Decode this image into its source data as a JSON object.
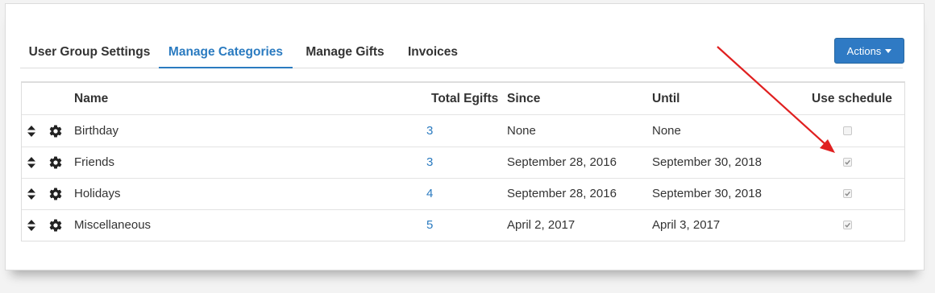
{
  "tabs": [
    {
      "label": "User Group Settings"
    },
    {
      "label": "Manage Categories",
      "active": true
    },
    {
      "label": "Manage Gifts"
    },
    {
      "label": "Invoices"
    }
  ],
  "actions": {
    "label": "Actions"
  },
  "table": {
    "headers": {
      "name": "Name",
      "total": "Total Egifts",
      "since": "Since",
      "until": "Until",
      "schedule": "Use schedule"
    },
    "rows": [
      {
        "name": "Birthday",
        "total": "3",
        "since": "None",
        "until": "None",
        "use_schedule": false
      },
      {
        "name": "Friends",
        "total": "3",
        "since": "September 28, 2016",
        "until": "September 30, 2018",
        "use_schedule": true
      },
      {
        "name": "Holidays",
        "total": "4",
        "since": "September 28, 2016",
        "until": "September 30, 2018",
        "use_schedule": true
      },
      {
        "name": "Miscellaneous",
        "total": "5",
        "since": "April 2, 2017",
        "until": "April 3, 2017",
        "use_schedule": true
      }
    ]
  },
  "icons": {
    "drag": "sort-icon",
    "settings": "gear-icon"
  },
  "colors": {
    "accent": "#2b7bc0",
    "button": "#2f7ac4",
    "annotation_arrow": "#e02020"
  }
}
